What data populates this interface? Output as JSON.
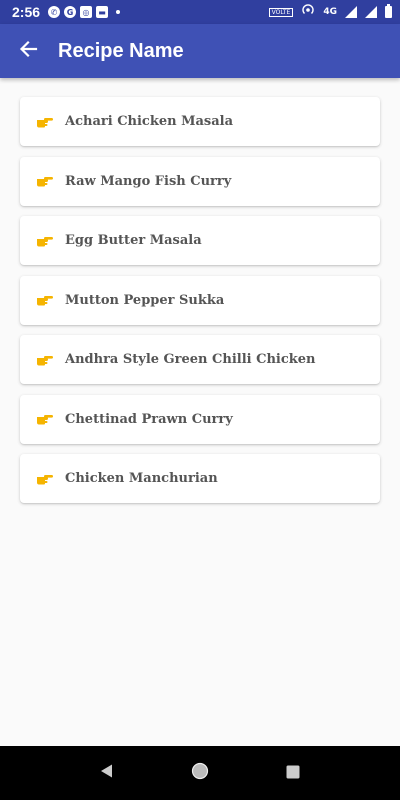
{
  "status_bar": {
    "time": "2:56",
    "network": "4G",
    "volte": "VOLTE"
  },
  "app_bar": {
    "title": "Recipe Name",
    "back_icon": "arrow-back-icon"
  },
  "recipes": [
    {
      "label": "Achari Chicken Masala",
      "icon": "pointing-hand-icon"
    },
    {
      "label": "Raw Mango Fish Curry",
      "icon": "pointing-hand-icon"
    },
    {
      "label": "Egg Butter Masala",
      "icon": "pointing-hand-icon"
    },
    {
      "label": "Mutton Pepper Sukka",
      "icon": "pointing-hand-icon"
    },
    {
      "label": "Andhra Style Green Chilli Chicken",
      "icon": "pointing-hand-icon"
    },
    {
      "label": "Chettinad Prawn Curry",
      "icon": "pointing-hand-icon"
    },
    {
      "label": "Chicken Manchurian",
      "icon": "pointing-hand-icon"
    }
  ],
  "colors": {
    "primary": "#3f51b5",
    "primary_dark": "#303f9f",
    "icon_accent": "#f5b400",
    "label_text": "#555555"
  }
}
